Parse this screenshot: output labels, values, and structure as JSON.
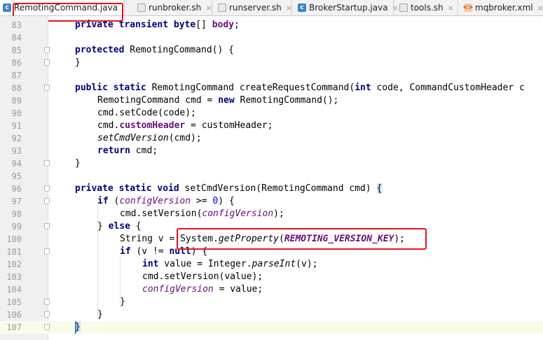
{
  "tabs": [
    {
      "label": "RemotingCommand.java",
      "icon": "java-class-icon",
      "active": true
    },
    {
      "label": "runbroker.sh",
      "icon": "shell-script-icon"
    },
    {
      "label": "runserver.sh",
      "icon": "shell-script-icon"
    },
    {
      "label": "BrokerStartup.java",
      "icon": "java-class-icon"
    },
    {
      "label": "tools.sh",
      "icon": "shell-script-icon"
    },
    {
      "label": "mqbroker.xml",
      "icon": "xml-file-icon"
    }
  ],
  "tab_close_glyph": "×",
  "tab_icon_glyphs": {
    "java": "c",
    "sh": "",
    "xml": "<>"
  },
  "lines": {
    "83": "83",
    "84": "84",
    "85": "85",
    "86": "86",
    "87": "87",
    "88": "88",
    "89": "89",
    "90": "90",
    "91": "91",
    "92": "92",
    "93": "93",
    "94": "94",
    "95": "95",
    "96": "96",
    "97": "97",
    "98": "98",
    "99": "99",
    "100": "100",
    "101": "101",
    "102": "102",
    "103": "103",
    "104": "104",
    "105": "105",
    "106": "106",
    "107": "107"
  },
  "code": {
    "l83": {
      "k1": "private",
      "k2": "transient",
      "k3": "byte",
      "t1": "[] ",
      "f1": "body",
      "t2": ";"
    },
    "l85": {
      "k1": "protected",
      "t1": " RemotingCommand() {"
    },
    "l86": {
      "t1": "}"
    },
    "l88": {
      "k1": "public",
      "k2": "static",
      "t1": " RemotingCommand createRequestCommand(",
      "k3": "int",
      "t2": " code, CommandCustomHeader c"
    },
    "l89": {
      "t1": "RemotingCommand cmd = ",
      "k1": "new",
      "t2": " RemotingCommand();"
    },
    "l90": {
      "t1": "cmd.setCode(code);"
    },
    "l91": {
      "t1": "cmd.",
      "f1": "customHeader",
      "t2": " = customHeader;"
    },
    "l92": {
      "i1": "setCmdVersion",
      "t1": "(cmd);"
    },
    "l93": {
      "k1": "return",
      "t1": " cmd;"
    },
    "l94": {
      "t1": "}"
    },
    "l96": {
      "k1": "private",
      "k2": "static",
      "k3": "void",
      "t1": " setCmdVersion(RemotingCommand cmd) ",
      "b1": "{"
    },
    "l97": {
      "k1": "if",
      "t1": " (",
      "f1": "configVersion",
      "t2": " >= ",
      "n1": "0",
      "t3": ") {"
    },
    "l98": {
      "t1": "cmd.setVersion(",
      "f1": "configVersion",
      "t2": ");"
    },
    "l99": {
      "t1": "} ",
      "k1": "else",
      "t2": " {"
    },
    "l100": {
      "t1": "String v = ",
      "t2": "System.",
      "i1": "getProperty",
      "t3": "(",
      "f1": "REMOTING_VERSION_KEY",
      "t4": ");"
    },
    "l101": {
      "k1": "if",
      "t1": " (v != ",
      "k2": "null",
      "t2": ") {"
    },
    "l102": {
      "k1": "int",
      "t1": " value = Integer.",
      "i1": "parseInt",
      "t2": "(v);"
    },
    "l103": {
      "t1": "cmd.setVersion(value);"
    },
    "l104": {
      "f1": "configVersion",
      "t1": " = value;"
    },
    "l105": {
      "t1": "}"
    },
    "l106": {
      "t1": "}"
    },
    "l107": {
      "b1": "}"
    }
  },
  "colors": {
    "keyword": "#000080",
    "field": "#660e7a",
    "number": "#0000ff",
    "highlight_box": "#e8141b",
    "current_line": "#fbfbea"
  }
}
